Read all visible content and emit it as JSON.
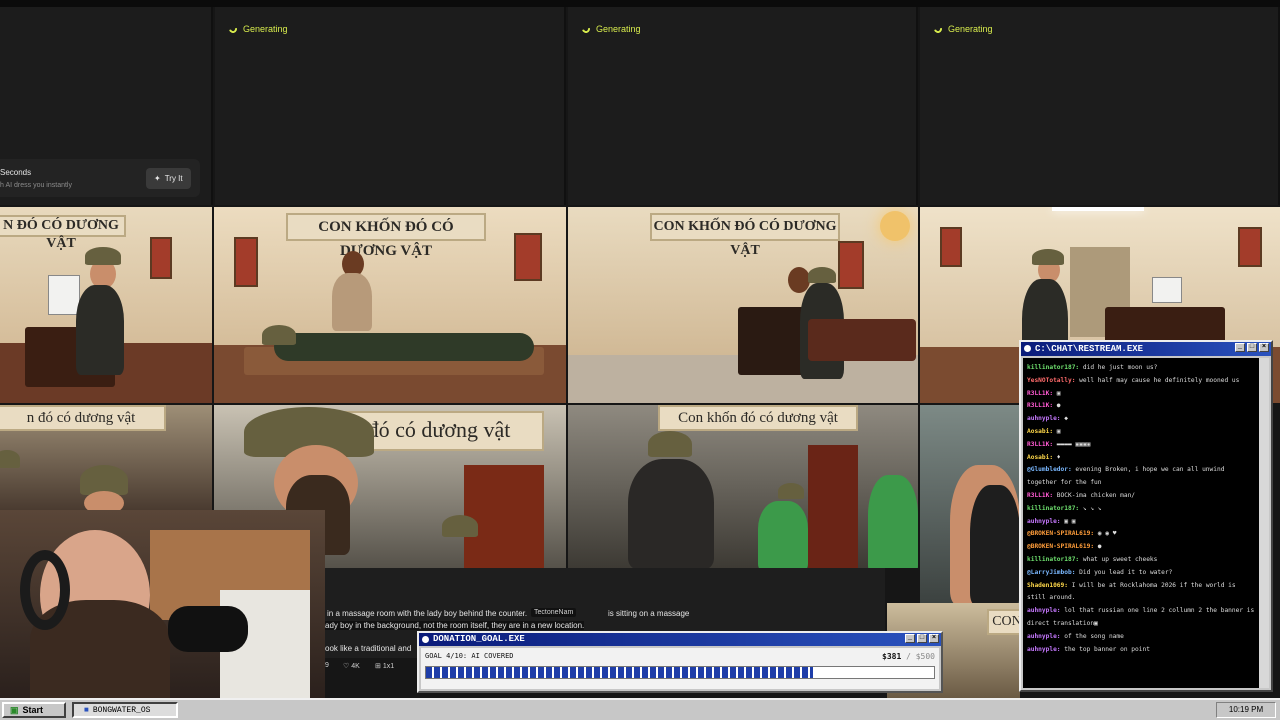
{
  "generating": {
    "label": "Generating"
  },
  "promo": {
    "title": "Seconds",
    "subtitle": "h AI dress you instantly",
    "button": "Try It"
  },
  "tiles": {
    "banner_full": "CON KHỐN ĐÓ CÓ DƯƠNG VẬT",
    "banner_partial_left": "n đó có dương vật",
    "banner_mixed": "Con khốn đó có dương vật",
    "banner_cut": "đó có dương vật",
    "banner_right_cut": "CON"
  },
  "prompt": {
    "line1": "in a massage room with the lady boy behind the counter.",
    "chip": "TectoneNam",
    "line1_end": "is sitting on a massage",
    "line2": "ady boy in the background, not the room itself, they are in a new location.",
    "line3": "ook like a traditional and",
    "meta": {
      "left": "9",
      "resolution": "4K",
      "ratio": "1x1"
    }
  },
  "donation": {
    "title": "DONATION_GOAL.EXE",
    "goal_label": "GOAL 4/10: AI COVERED",
    "current": "$381",
    "total": "/ $500",
    "progress": 0.762
  },
  "chat": {
    "title": "C:\\CHAT\\RESTREAM.EXE",
    "messages": [
      {
        "user": "killinator187:",
        "color": "#6ee06e",
        "text": "did he just moon us?"
      },
      {
        "user": "YesNOTotally:",
        "color": "#ff6b6b",
        "text": "well half may cause he definitely mooned us"
      },
      {
        "user": "R3LL1K:",
        "color": "#ff5ad1",
        "text": "▣"
      },
      {
        "user": "R3LL1K:",
        "color": "#ff5ad1",
        "text": "●"
      },
      {
        "user": "auhnyple:",
        "color": "#c678ff",
        "text": "◆"
      },
      {
        "user": "Aosabi:",
        "color": "#ffd84a",
        "text": "▣"
      },
      {
        "user": "R3LL1K:",
        "color": "#ff5ad1",
        "text": "▬▬▬▬ ▣▣▣▣"
      },
      {
        "user": "Aosabi:",
        "color": "#ffd84a",
        "text": "♦"
      },
      {
        "user": "@Glumbledor:",
        "color": "#7ab8ff",
        "text": "evening Broken, i hope we can all unwind together for the fun"
      },
      {
        "user": "R3LL1K:",
        "color": "#ff5ad1",
        "text": "BOCK-ima chicken man/"
      },
      {
        "user": "killinator187:",
        "color": "#6ee06e",
        "text": "↘ ↘ ↘"
      },
      {
        "user": "auhnyple:",
        "color": "#c678ff",
        "text": "▣ ▣"
      },
      {
        "user": "@BROKEN-SPIRAL619:",
        "color": "#ff9d3a",
        "text": "◉ ◉ ♥"
      },
      {
        "user": "@BROKEN-SPIRAL619:",
        "color": "#ff9d3a",
        "text": "●"
      },
      {
        "user": "killinator187:",
        "color": "#6ee06e",
        "text": "what up sweet cheeks"
      },
      {
        "user": "@LarryJimbob:",
        "color": "#7ab8ff",
        "text": "Did you lead it to water?"
      },
      {
        "user": "Shaden1069:",
        "color": "#ffd84a",
        "text": "I will be at Rocklahoma 2026 if the world is still around."
      },
      {
        "user": "auhnyple:",
        "color": "#c678ff",
        "text": "lol that russian one line 2 collumn 2 the banner is direct translation▣"
      },
      {
        "user": "auhnyple:",
        "color": "#c678ff",
        "text": "of the song name"
      },
      {
        "user": "auhnyple:",
        "color": "#c678ff",
        "text": "the top banner on point"
      }
    ]
  },
  "taskbar": {
    "start": "Start",
    "task": "BONGWATER_OS",
    "clock": "10:19 PM"
  },
  "colors": {
    "accent_yellow": "#d8ec4d",
    "win_blue": "#0a1b7a",
    "win_gray": "#c7c7c7"
  },
  "icons": [
    "spinner-icon",
    "sparkle-icon",
    "window-minimize-icon",
    "window-maximize-icon",
    "window-close-icon",
    "start-logo-icon",
    "app-icon"
  ]
}
